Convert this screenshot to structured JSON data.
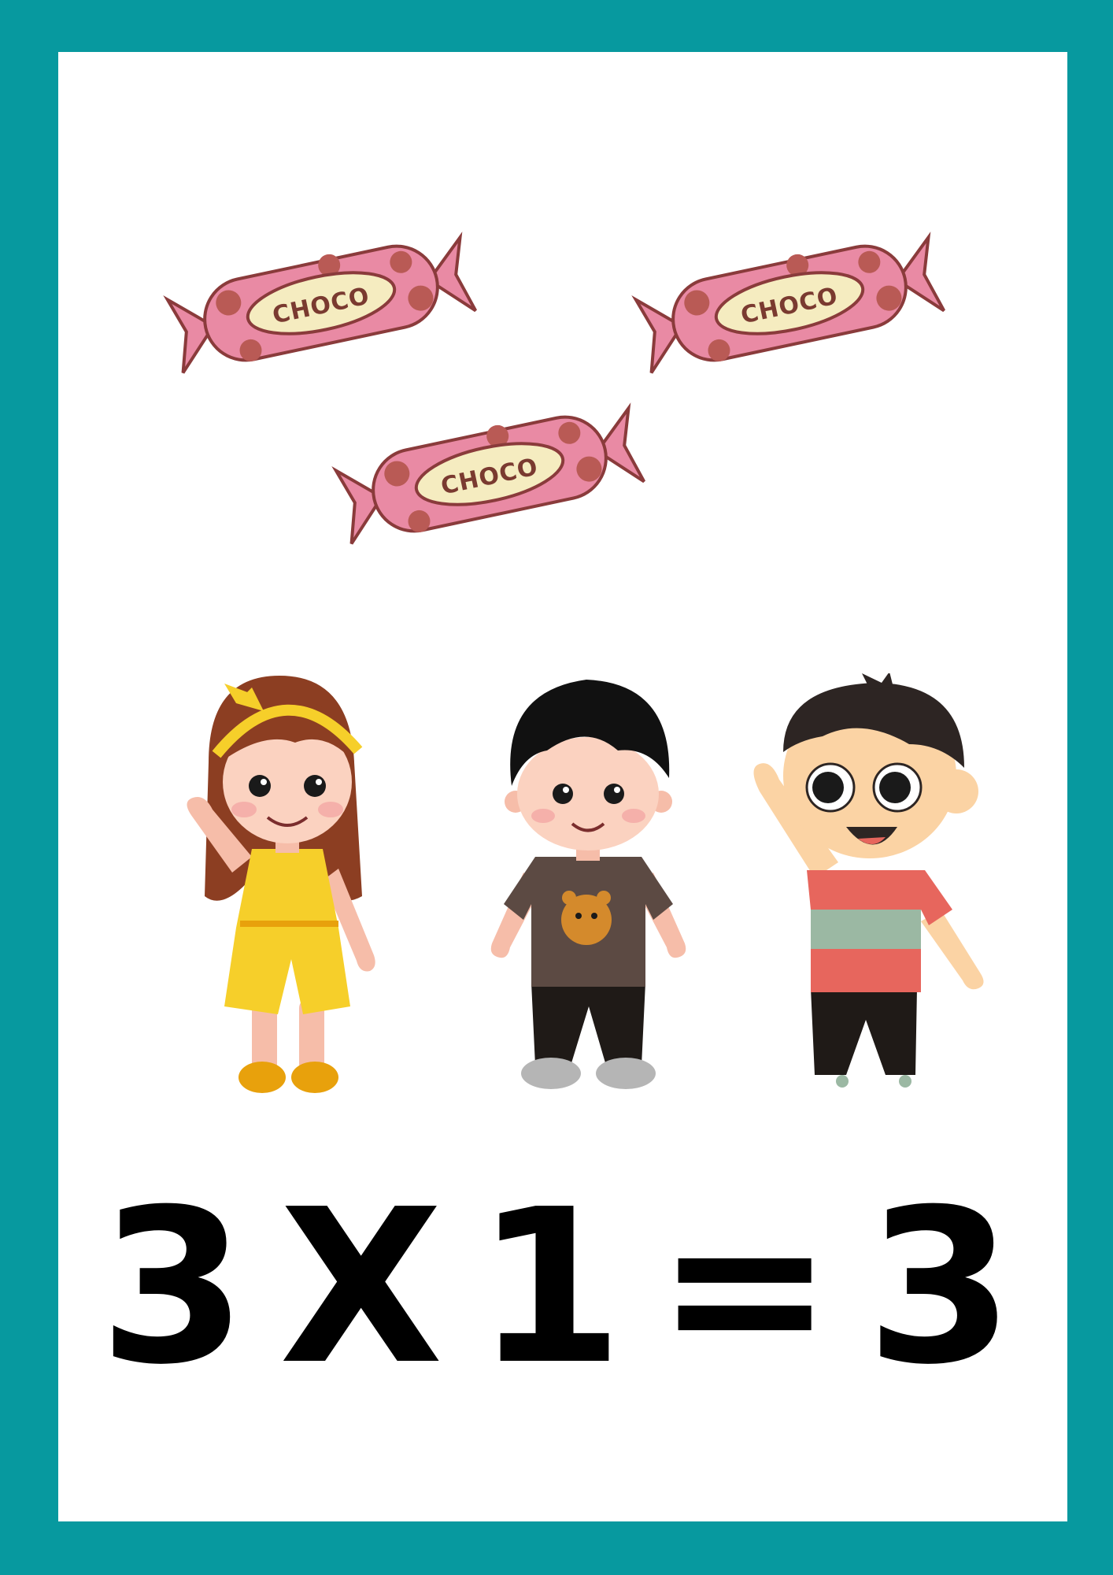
{
  "colors": {
    "border": "#07999f",
    "card": "#ffffff",
    "candy_pink": "#e98aa4",
    "candy_spot": "#b95a55",
    "candy_outline": "#8a3b3b",
    "candy_label_bg": "#f5ecc0",
    "equation": "#000000"
  },
  "candies": [
    {
      "label": "CHOCO"
    },
    {
      "label": "CHOCO"
    },
    {
      "label": "CHOCO"
    }
  ],
  "kids": [
    {
      "icon": "girl-yellow-dress-illustration"
    },
    {
      "icon": "boy-bear-shirt-illustration"
    },
    {
      "icon": "boy-waving-striped-shirt-illustration"
    }
  ],
  "equation": {
    "left": "3",
    "operator": "X",
    "right": "1",
    "equals": "=",
    "result": "3"
  }
}
